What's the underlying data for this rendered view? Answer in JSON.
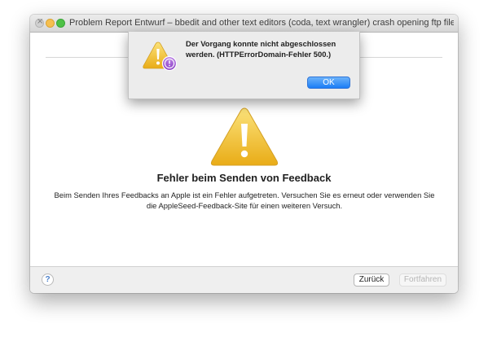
{
  "window": {
    "title": "Problem Report Entwurf – bbedit and other text editors (coda, text wrangler) crash opening ftp files on el capitan"
  },
  "content": {
    "heading": "Fehler beim Senden von Feedback",
    "message": "Beim Senden Ihres Feedbacks an Apple ist ein Fehler aufgetreten. Versuchen Sie es erneut oder verwenden Sie die AppleSeed-Feedback-Site für einen weiteren Versuch."
  },
  "footer": {
    "help_label": "?",
    "back_label": "Zurück",
    "continue_label": "Fortfahren"
  },
  "alert": {
    "message": "Der Vorgang konnte nicht abgeschlossen werden. (HTTPErrorDomain-Fehler 500.)",
    "ok_label": "OK"
  },
  "icons": {
    "warning": "warning-triangle-icon",
    "badge": "feedback-assistant-badge-icon"
  },
  "colors": {
    "warning_yellow": "#f4c534",
    "badge_purple": "#9b4fd1",
    "ok_blue": "#1b7df6"
  }
}
